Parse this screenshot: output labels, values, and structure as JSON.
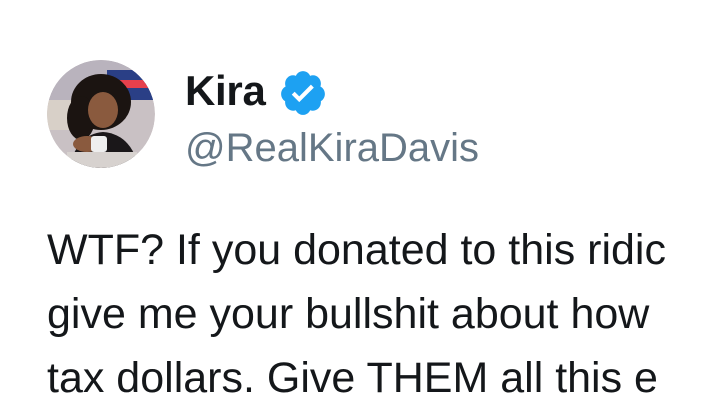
{
  "tweet": {
    "author": {
      "display_name": "Kira",
      "handle": "@RealKiraDavis",
      "verified": true,
      "avatar_icon": "profile-photo",
      "badge_icon": "verified-check-icon"
    },
    "text_lines": [
      "WTF? If you donated to this ridic",
      "give me your bullshit about how",
      "tax dollars. Give THEM all this e"
    ]
  },
  "colors": {
    "name": "#14171a",
    "handle": "#657786",
    "text": "#14171a",
    "verified_badge": "#1da1f2",
    "background": "#ffffff"
  }
}
